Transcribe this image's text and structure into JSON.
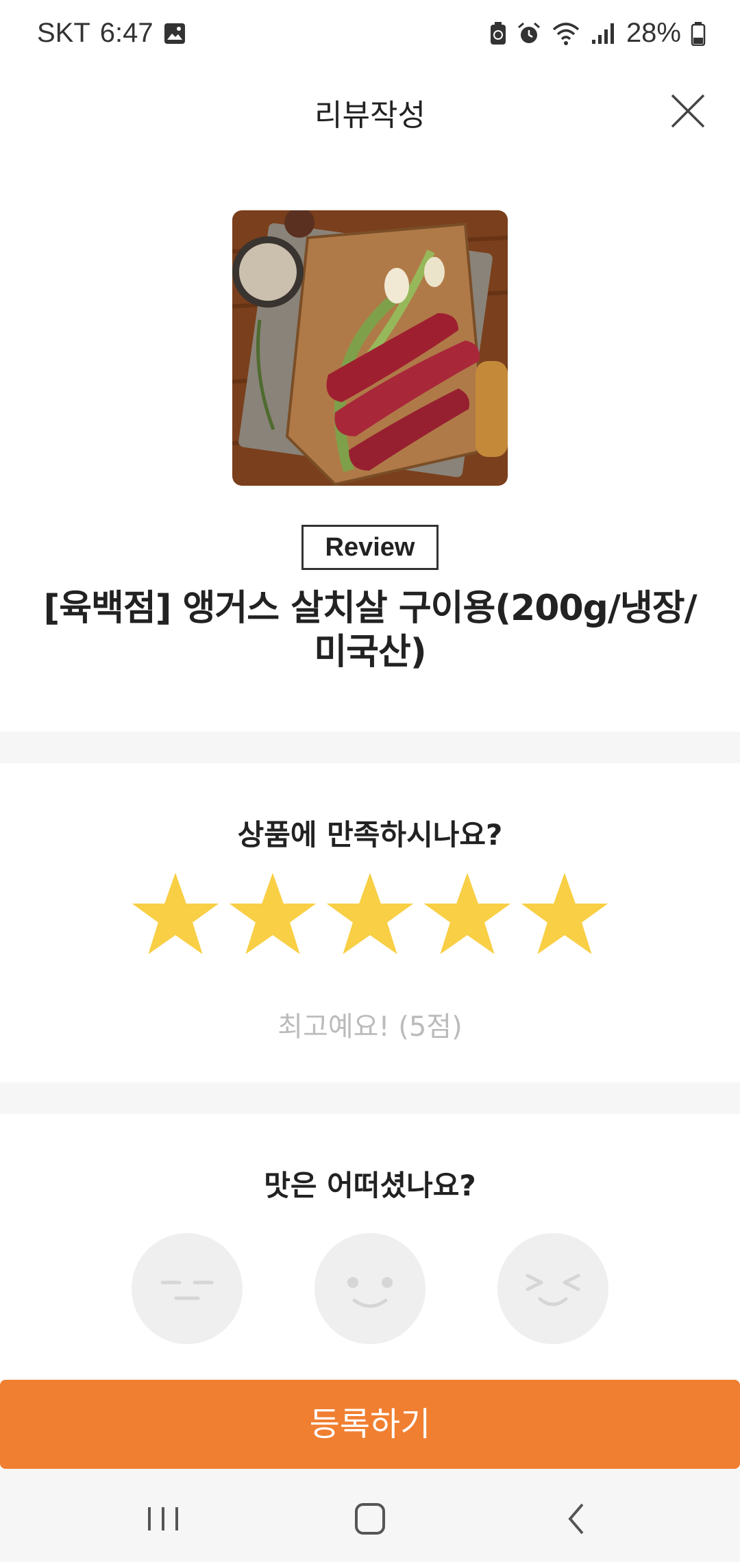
{
  "status_bar": {
    "carrier": "SKT",
    "time": "6:47",
    "battery": "28%",
    "icons": [
      "gallery-icon",
      "battery-saver-icon",
      "alarm-icon",
      "wifi-icon",
      "signal-icon",
      "battery-icon"
    ]
  },
  "header": {
    "title": "리뷰작성",
    "close_icon": "close-icon"
  },
  "product": {
    "badge": "Review",
    "name": "[육백점] 앵거스 살치살 구이용(200g/냉장/미국산)"
  },
  "rating": {
    "question": "상품에 만족하시나요?",
    "stars_filled": 5,
    "stars_total": 5,
    "star_color": "#f8cf45",
    "label": "최고예요! (5점)"
  },
  "taste": {
    "question": "맛은 어떠셨나요?",
    "options": [
      "neutral-face-icon",
      "smile-face-icon",
      "happy-face-icon"
    ]
  },
  "actions": {
    "register_label": "등록하기",
    "register_color": "#f07f31"
  },
  "nav": {
    "icons": [
      "recent-apps-icon",
      "home-icon",
      "back-icon"
    ]
  }
}
